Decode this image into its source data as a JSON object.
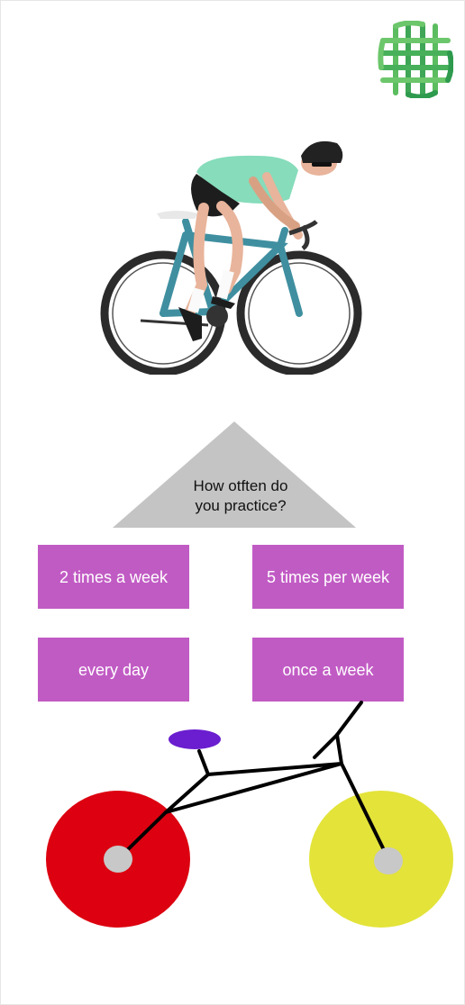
{
  "logo": {
    "icon": "interlaced-lattice-logo",
    "color_light": "#6cc66b",
    "color_dark": "#2e9a4e"
  },
  "hero": {
    "icon": "cyclist-illustration"
  },
  "question": {
    "line1": "How otften do",
    "line2": "you practice?",
    "shape_color": "#c4c4c4"
  },
  "answers": [
    {
      "label": "2 times a week"
    },
    {
      "label": "5 times per week"
    },
    {
      "label": "every day"
    },
    {
      "label": "once a week"
    }
  ],
  "answer_color": "#c15bc4",
  "bike_drawing": {
    "icon": "simple-bicycle-drawing",
    "rear_wheel_color": "#dc0010",
    "front_wheel_color": "#e3e33a",
    "hub_color": "#c8c8c8",
    "saddle_color": "#6a1ecf"
  }
}
